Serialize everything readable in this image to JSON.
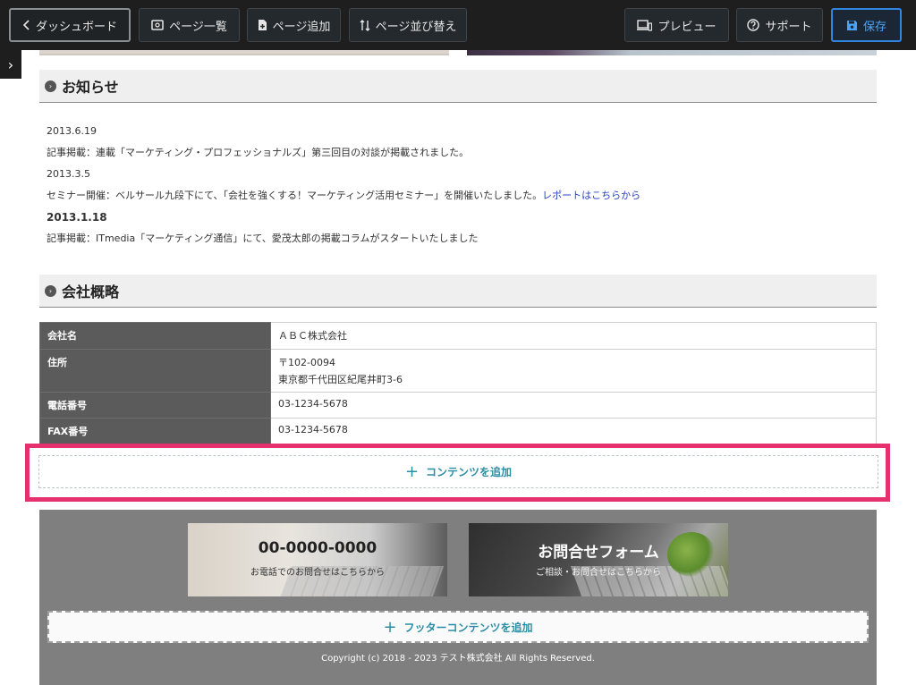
{
  "toolbar": {
    "dashboard_label": "ダッシュボード",
    "page_list_label": "ページ一覧",
    "page_add_label": "ページ追加",
    "page_sort_label": "ページ並び替え",
    "preview_label": "プレビュー",
    "support_label": "サポート",
    "save_label": "保存"
  },
  "news": {
    "heading": "お知らせ",
    "items": [
      {
        "date": "2013.6.19",
        "text": "記事掲載：連載「マーケティング・プロフェッショナルズ」第三回目の対談が掲載されました。",
        "link": ""
      },
      {
        "date": "2013.3.5",
        "text": "セミナー開催：ベルサール九段下にて、「会社を強くする！マーケティング活用セミナー」を開催いたしました。",
        "link": "レポートはこちらから"
      },
      {
        "date": "2013.1.18",
        "text": "記事掲載：ITmedia「マーケティング通信」にて、愛茂太郎の掲載コラムがスタートいたしました",
        "link": ""
      }
    ]
  },
  "company": {
    "heading": "会社概略",
    "rows": [
      {
        "label": "会社名",
        "value": "ＡＢＣ株式会社",
        "value2": ""
      },
      {
        "label": "住所",
        "value": "〒102-0094",
        "value2": "東京都千代田区紀尾井町3-6"
      },
      {
        "label": "電話番号",
        "value": "03-1234-5678",
        "value2": ""
      },
      {
        "label": "FAX番号",
        "value": "03-1234-5678",
        "value2": ""
      }
    ]
  },
  "add_content_label": "コンテンツを追加",
  "footer": {
    "phone_banner_title": "00-0000-0000",
    "phone_banner_sub": "お電話でのお問合せはこちらから",
    "form_banner_title": "お問合せフォーム",
    "form_banner_sub": "ご相談・お問合せはこちらから",
    "add_footer_label": "フッターコンテンツを追加",
    "copyright": "Copyright (c) 2018 - 2023 テスト株式会社 All Rights Reserved."
  },
  "colors": {
    "highlight": "#e5326f",
    "accent_teal": "#2b8da3",
    "save_blue": "#2f86de"
  }
}
